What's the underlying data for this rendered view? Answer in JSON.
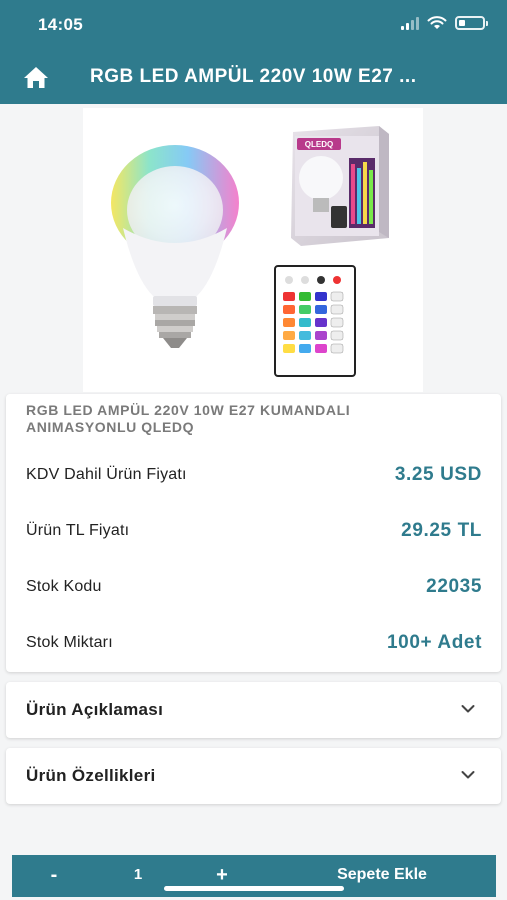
{
  "status_bar": {
    "time": "14:05"
  },
  "header": {
    "home_icon": "home-icon",
    "title": "RGB LED AMPÜL 220V 10W E27 ..."
  },
  "product_image": {
    "box_brand": "QLEDQ"
  },
  "product": {
    "name": "RGB LED AMPÜL 220V 10W E27 KUMANDALI ANIMASYONLU QLEDQ",
    "rows": [
      {
        "label": "KDV Dahil Ürün Fiyatı",
        "value": "3.25 USD"
      },
      {
        "label": "Ürün TL Fiyatı",
        "value": "29.25 TL"
      },
      {
        "label": "Stok Kodu",
        "value": "22035"
      },
      {
        "label": "Stok Miktarı",
        "value": "100+ Adet"
      }
    ]
  },
  "accordions": [
    {
      "label": "Ürün Açıklaması",
      "icon": "chevron-down-icon"
    },
    {
      "label": "Ürün Özellikleri",
      "icon": "chevron-down-icon"
    }
  ],
  "cart_bar": {
    "minus": "-",
    "quantity": "1",
    "plus": "+",
    "add_to_cart": "Sepete Ekle"
  },
  "colors": {
    "primary": "#2f7b8d",
    "background": "#f4f5f6"
  }
}
